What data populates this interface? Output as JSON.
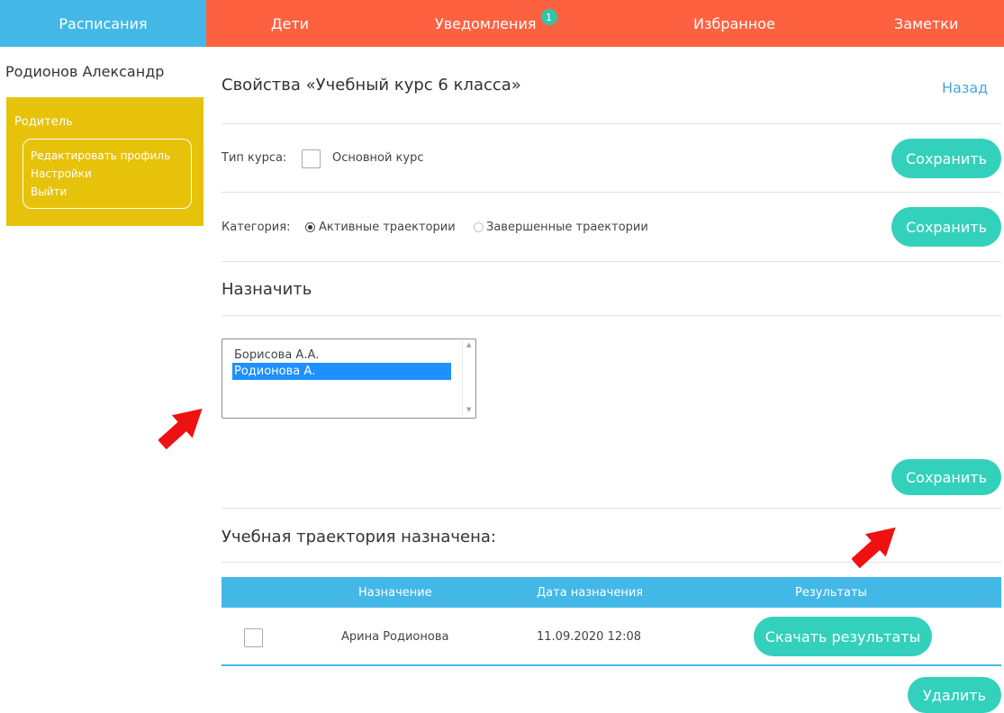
{
  "nav": {
    "schedules": "Расписания",
    "children": "Дети",
    "notifications": "Уведомления",
    "notifications_count": "1",
    "favorites": "Избранное",
    "notes": "Заметки"
  },
  "sidebar": {
    "user_name": "Родионов Александр",
    "role": "Родитель",
    "menu": [
      "Редактировать профиль",
      "Настройки",
      "Выйти"
    ]
  },
  "page": {
    "title": "Свойства «Учебный курс 6 класса»",
    "back": "Назад"
  },
  "course_type": {
    "label": "Тип курса:",
    "checkbox_label": "Основной курс",
    "checked": false,
    "save": "Сохранить"
  },
  "category": {
    "label": "Категория:",
    "options": [
      "Активные траектории",
      "Завершенные траектории"
    ],
    "selected": "Активные траектории",
    "save": "Сохранить"
  },
  "assign": {
    "title": "Назначить",
    "list": [
      "Борисова А.А.",
      "Родионова А."
    ],
    "selected": "Родионова А.",
    "save": "Сохранить"
  },
  "assigned": {
    "title": "Учебная траектория назначена:",
    "columns": [
      "Назначение",
      "Дата назначения",
      "Результаты"
    ],
    "rows": [
      {
        "name": "Арина Родионова",
        "date": "11.09.2020 12:08",
        "action": "Скачать результаты"
      }
    ],
    "delete": "Удалить"
  },
  "colors": {
    "nav_blue": "#43b8e6",
    "nav_orange": "#fe6140",
    "sidebar_yellow": "#e6c20b",
    "button_teal": "#33d1bb",
    "selection_blue": "#1e90ff",
    "annotation_red": "#ee1111"
  }
}
